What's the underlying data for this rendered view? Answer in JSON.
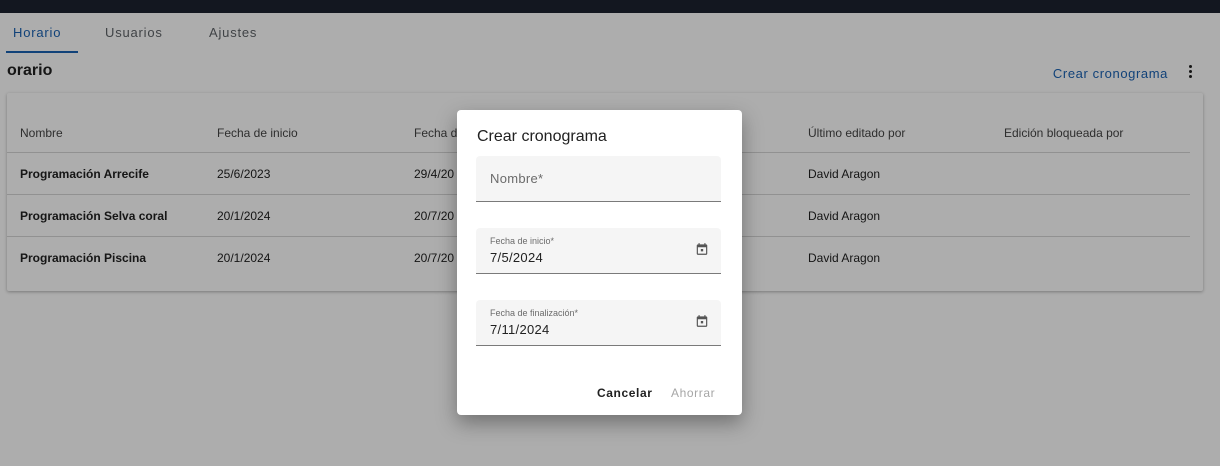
{
  "tabs": [
    {
      "label": "Horario",
      "active": true
    },
    {
      "label": "Usuarios",
      "active": false
    },
    {
      "label": "Ajustes",
      "active": false
    }
  ],
  "page": {
    "title": "orario",
    "create_link": "Crear cronograma",
    "more_icon": "more-vert-icon"
  },
  "table": {
    "headers": [
      "Nombre",
      "Fecha de inicio",
      "Fecha de",
      "Último editado por",
      "Edición bloqueada por"
    ],
    "rows": [
      {
        "name": "Programación Arrecife",
        "start": "25/6/2023",
        "end": "29/4/20",
        "editor": "David Aragon",
        "locked_by": ""
      },
      {
        "name": "Programación Selva coral",
        "start": "20/1/2024",
        "end": "20/7/20",
        "editor": "David Aragon",
        "locked_by": ""
      },
      {
        "name": "Programación Piscina",
        "start": "20/1/2024",
        "end": "20/7/20",
        "editor": "David Aragon",
        "locked_by": ""
      }
    ]
  },
  "dialog": {
    "title": "Crear cronograma",
    "name_placeholder": "Nombre*",
    "start_label": "Fecha de inicio*",
    "start_value": "7/5/2024",
    "end_label": "Fecha de finalización*",
    "end_value": "7/11/2024",
    "cancel_label": "Cancelar",
    "save_label": "Ahorrar",
    "calendar_icon": "calendar-icon"
  },
  "colors": {
    "accent": "#1a62b3",
    "topbar": "#1c2330",
    "scrim": "rgba(0,0,0,0.32)"
  }
}
